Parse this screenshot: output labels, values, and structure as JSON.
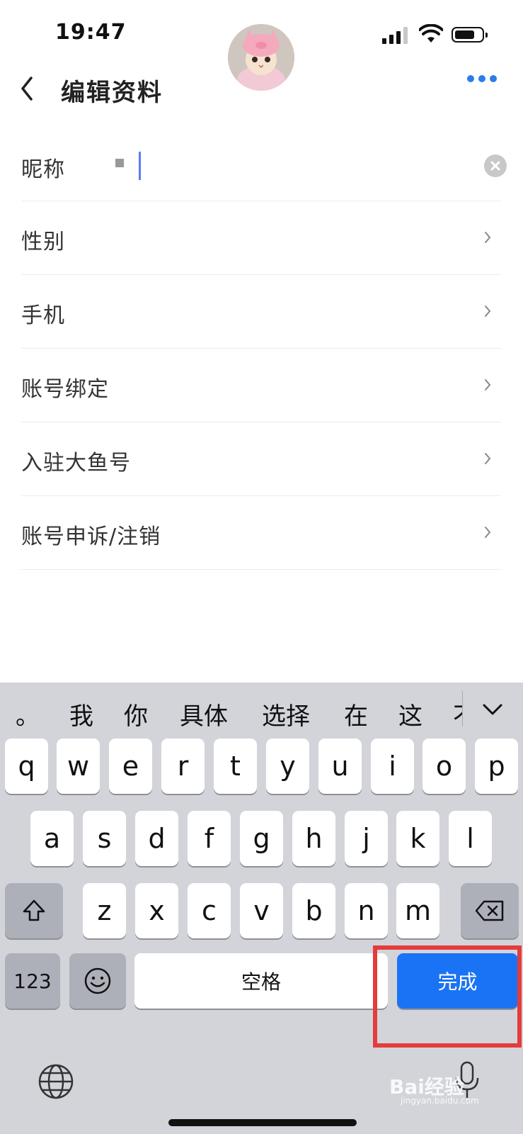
{
  "status_bar": {
    "time": "19:47"
  },
  "header": {
    "title": "编辑资料"
  },
  "form": {
    "nickname": {
      "label": "昵称",
      "value": ""
    },
    "rows": [
      {
        "label": "性别"
      },
      {
        "label": "手机"
      },
      {
        "label": "账号绑定"
      },
      {
        "label": "入驻大鱼号"
      },
      {
        "label": "账号申诉/注销"
      }
    ]
  },
  "keyboard": {
    "candidates": [
      "。",
      "我",
      "你",
      "具体",
      "选择",
      "在",
      "这",
      "不"
    ],
    "row1": [
      "q",
      "w",
      "e",
      "r",
      "t",
      "y",
      "u",
      "i",
      "o",
      "p"
    ],
    "row2": [
      "a",
      "s",
      "d",
      "f",
      "g",
      "h",
      "j",
      "k",
      "l"
    ],
    "row3": [
      "z",
      "x",
      "c",
      "v",
      "b",
      "n",
      "m"
    ],
    "numbers_label": "123",
    "space_label": "空格",
    "done_label": "完成"
  },
  "watermark": {
    "brand": "Bai经验",
    "url": "jingyan.baidu.com"
  },
  "colors": {
    "accent": "#1a73f5",
    "highlight": "#e43b3b",
    "keyboard_bg": "#d2d4da"
  }
}
